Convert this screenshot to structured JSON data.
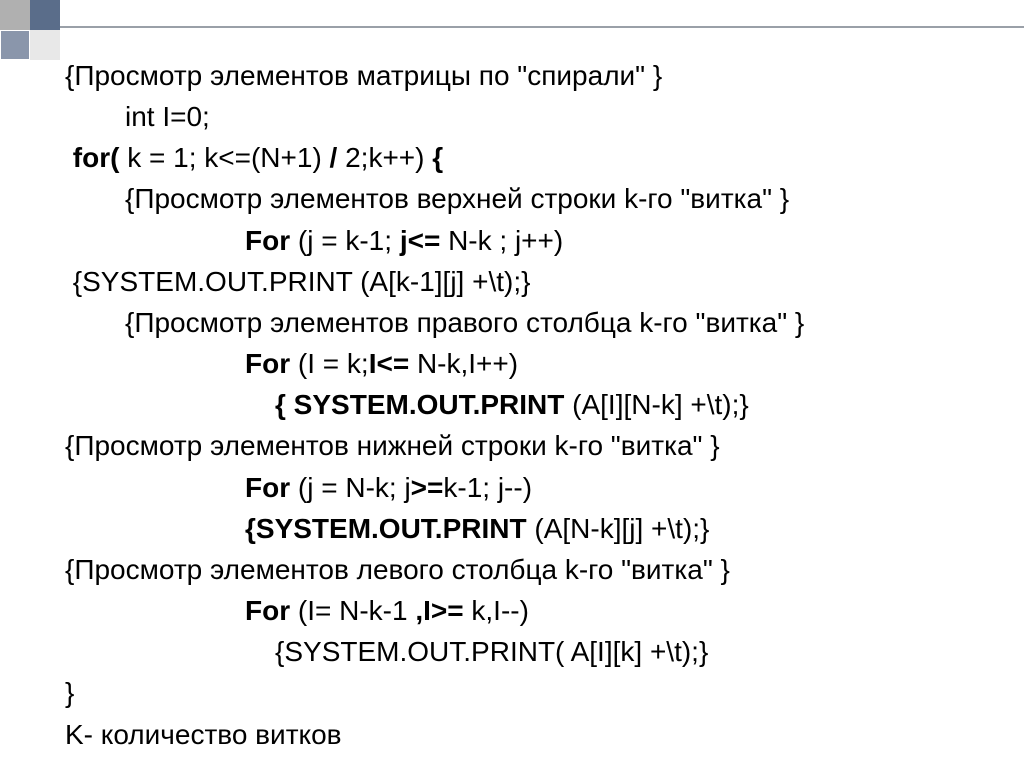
{
  "lines": {
    "l1": "{Просмотр элементов матрицы по \"спирали\" }",
    "l2": "int І=0;",
    "l3a": " for(",
    "l3b": " k = 1; k<=",
    "l3c": "(N+1) ",
    "l3d": "/",
    "l3e": " 2;k++) ",
    "l3f": "{",
    "l4": "{Просмотр элементов верхней строки k-го \"витка\" }",
    "l5a": "For",
    "l5b": " (j = k-1; ",
    "l5c": "j<=",
    "l5d": " N-k ; j++)",
    "l6": " {SYSTEM.OUT.PRINT (A[k-1][j] +\\t);}",
    "l7": "{Просмотр элементов правого столбца k-го \"витка\" }",
    "l8a": "For",
    "l8b": " (I = k;",
    "l8c": "I<=",
    "l8d": " N-k,I++)",
    "l9a": "{",
    "l9b": " SYSTEM.OUT.PRINT",
    "l9c": " (A[I][N-k] +\\t);}",
    "l10": "{Просмотр элементов нижней строки k-го \"витка\" }",
    "l11a": "For",
    "l11b": " (j = N-k; j",
    "l11c": ">=",
    "l11d": "k-1; j--)",
    "l12a": "{SYSTEM.OUT.PRINT",
    "l12b": " (A[N-k][j] +\\t);}",
    "l13": "{Просмотр элементов левого столбца k-го \"витка\" }",
    "l14a": "For",
    "l14b": " (I= N-k-1 ",
    "l14c": ",I>=",
    "l14d": " k,I--)",
    "l15": "{SYSTEM.OUT.PRINT( A[I][k] +\\t);}",
    "l16": "}",
    "l17": "K- количество витков"
  }
}
